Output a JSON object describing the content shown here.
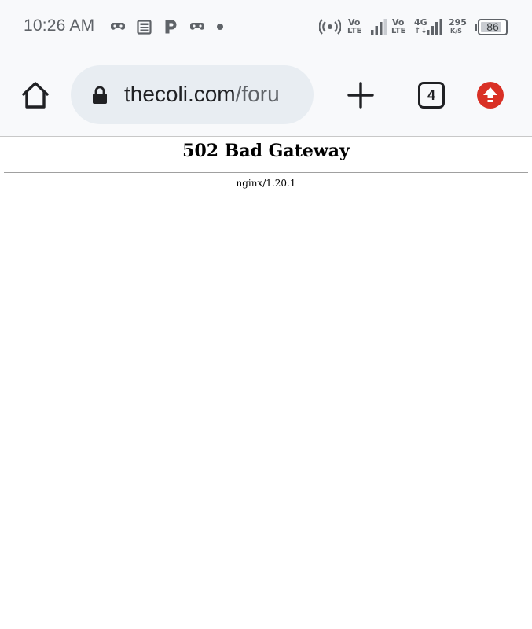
{
  "status_bar": {
    "time": "10:26 AM",
    "notification_icons": [
      "game-controller-icon",
      "news-icon",
      "p-app-icon",
      "game-controller-icon",
      "dot-icon"
    ],
    "hotspot_icon": "wifi-calling-icon",
    "sim1": {
      "volte_top": "Vo",
      "volte_bottom": "LTE",
      "signal_bars": 3
    },
    "sim2": {
      "volte_top": "Vo",
      "volte_bottom": "LTE",
      "network": "4G",
      "data_arrows": "↑↓",
      "signal_bars": 4
    },
    "net_speed_value": "295",
    "net_speed_unit": "K/S",
    "battery_text": "86",
    "battery_level": 0.86
  },
  "toolbar": {
    "home_icon": "home-icon",
    "lock_icon": "lock-icon",
    "url_host": "thecoli.com",
    "url_path": "/foru",
    "new_tab_icon": "plus-icon",
    "tab_count": "4",
    "update_icon": "arrow-up-icon"
  },
  "page": {
    "title": "502 Bad Gateway",
    "server": "nginx/1.20.1"
  },
  "colors": {
    "status_bar_bg": "#f8f9fb",
    "url_bar_bg": "#e8edf2",
    "update_badge": "#d93025",
    "icon_gray": "#5f6368"
  }
}
